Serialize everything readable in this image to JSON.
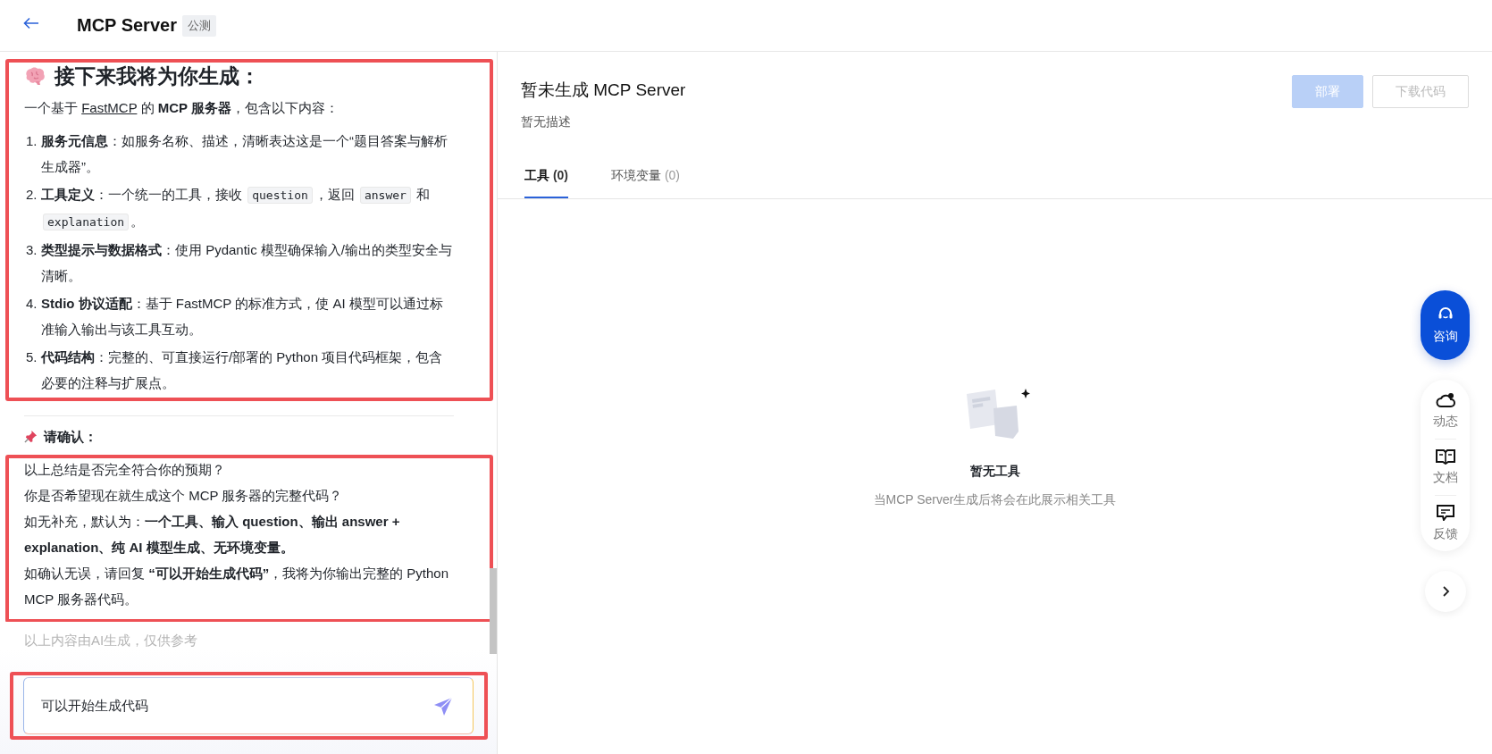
{
  "header": {
    "title": "MCP Server",
    "badge": "公测"
  },
  "chat": {
    "sections": [
      {
        "highlighted": true,
        "blocks": [
          {
            "kind": "heading",
            "text": "接下来我将为你生成："
          },
          {
            "kind": "paragraph",
            "parts": [
              {
                "kind": "text",
                "text": "一个基于 "
              },
              {
                "kind": "link",
                "text": "FastMCP"
              },
              {
                "kind": "text",
                "text": " 的 **MCP 服务器**，包含以下内容："
              }
            ]
          },
          {
            "kind": "list_item",
            "number": "1.",
            "parts": [
              {
                "kind": "text",
                "text": "**服务元信息**：如服务名称、描述，清晰表达这是一个“题目答案与解析生成器”。"
              }
            ]
          },
          {
            "kind": "list_item",
            "number": "2.",
            "parts": [
              {
                "kind": "text",
                "text": "**工具定义**：一个统一的工具，接收 "
              },
              {
                "kind": "code",
                "text": "question"
              },
              {
                "kind": "text",
                "text": "，返回 "
              },
              {
                "kind": "code",
                "text": "answer"
              },
              {
                "kind": "text",
                "text": " 和 "
              },
              {
                "kind": "code",
                "text": "explanation"
              },
              {
                "kind": "text",
                "text": "。"
              }
            ]
          },
          {
            "kind": "list_item",
            "number": "3.",
            "parts": [
              {
                "kind": "text",
                "text": "**类型提示与数据格式**：使用 Pydantic 模型确保输入/输出的类型安全与清晰。"
              }
            ]
          },
          {
            "kind": "list_item",
            "number": "4.",
            "parts": [
              {
                "kind": "text",
                "text": "**Stdio 协议适配**：基于 FastMCP 的标准方式，使 AI 模型可以通过标准输入输出与该工具互动。"
              }
            ]
          },
          {
            "kind": "list_item",
            "number": "5.",
            "parts": [
              {
                "kind": "text",
                "text": "**代码结构**：完整的、可直接运行/部署的 Python 项目代码框架，包含必要的注释与扩展点。"
              }
            ]
          }
        ]
      },
      {
        "highlighted": false,
        "blocks": [
          {
            "kind": "divider"
          },
          {
            "kind": "subheading",
            "text": "请确认："
          }
        ]
      },
      {
        "highlighted": true,
        "blocks": [
          {
            "kind": "line",
            "parts": [
              {
                "kind": "text",
                "text": "以上总结是否完全符合你的预期？"
              }
            ]
          },
          {
            "kind": "line",
            "parts": [
              {
                "kind": "text",
                "text": "你是否希望现在就生成这个 MCP 服务器的完整代码？"
              }
            ]
          },
          {
            "kind": "line",
            "parts": [
              {
                "kind": "text",
                "text": "如无补充，默认为：**一个工具、输入 question、输出 answer + explanation、纯 AI 模型生成、无环境变量。**"
              }
            ]
          },
          {
            "kind": "paragraph",
            "parts": [
              {
                "kind": "text",
                "text": "如确认无误，请回复 **“可以开始生成代码”**，我将为你输出完整的 Python MCP 服务器代码。"
              }
            ]
          }
        ]
      }
    ],
    "note": "以上内容由AI生成，仅供参考"
  },
  "input": {
    "value": "可以开始生成代码",
    "highlighted": true
  },
  "server": {
    "title": "暂未生成 MCP Server",
    "description": "暂无描述",
    "buttons": [
      {
        "label": "部署",
        "kind": "primary",
        "disabled": true
      },
      {
        "label": "下载代码",
        "kind": "default",
        "disabled": true
      }
    ],
    "tabs": [
      {
        "label": "工具",
        "count": "(0)",
        "selected": true
      },
      {
        "label": "环境变量",
        "count": "(0)",
        "selected": false
      }
    ],
    "empty": {
      "title": "暂无工具",
      "description": "当MCP Server生成后将会在此展示相关工具"
    }
  },
  "float": {
    "consult": {
      "label": "咨询"
    },
    "items": [
      {
        "kind": "cloud",
        "label": "动态"
      },
      {
        "kind": "book",
        "label": "文档"
      },
      {
        "kind": "feedback",
        "label": "反馈"
      }
    ]
  }
}
